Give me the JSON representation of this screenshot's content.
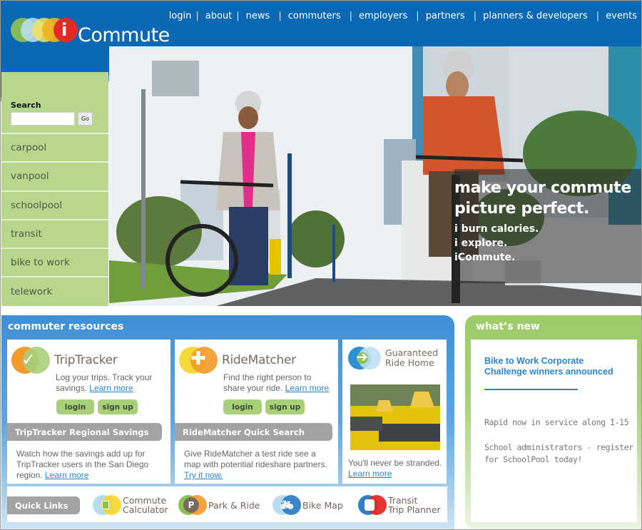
{
  "header": {
    "logo_text": "Commute",
    "logo_letter": "i",
    "nav": [
      {
        "label": "login"
      },
      {
        "label": "about"
      },
      {
        "label": "news"
      },
      {
        "label": "commuters"
      },
      {
        "label": "employers"
      },
      {
        "label": "partners"
      },
      {
        "label": "planners & developers"
      },
      {
        "label": "events"
      }
    ]
  },
  "sidebar": {
    "search_label": "Search",
    "search_value": "",
    "go_label": "Go",
    "items": [
      {
        "label": "carpool"
      },
      {
        "label": "vanpool"
      },
      {
        "label": "schoolpool"
      },
      {
        "label": "transit"
      },
      {
        "label": "bike to work"
      },
      {
        "label": "telework"
      }
    ]
  },
  "hero": {
    "headline_line1": "make your commute",
    "headline_line2": "picture perfect.",
    "sub1": "i burn calories.",
    "sub2": "i explore.",
    "sub3": "iCommute."
  },
  "resources": {
    "title": "commuter resources",
    "triptracker": {
      "name": "TripTracker",
      "desc": "Log your trips. Track your savings. ",
      "learn_more": "Learn more",
      "login": "login",
      "signup": "sign up",
      "bar_title": "TripTracker Regional Savings",
      "bottom_desc": "Watch how the savings add up for TripTracker users in the San Diego region. ",
      "bottom_link": "Learn more"
    },
    "ridematcher": {
      "name": "RideMatcher",
      "desc": "Find the right person to share your ride. ",
      "learn_more": "Learn more",
      "login": "login",
      "signup": "sign up",
      "bar_title": "RideMatcher Quick Search",
      "bottom_desc": "Give RideMatcher a test ride see a map with potential rideshare partners. ",
      "bottom_link": "Try it now."
    },
    "grh": {
      "name_line1": "Guaranteed",
      "name_line2": "Ride Home",
      "desc": "You'll never be stranded.",
      "learn_more": "Learn more"
    },
    "quick_links": {
      "label": "Quick Links",
      "items": [
        {
          "line1": "Commute",
          "line2": "Calculator",
          "icon": "calculator-icon"
        },
        {
          "line1": "Park & Ride",
          "line2": "",
          "icon": "parking-icon"
        },
        {
          "line1": "Bike Map",
          "line2": "",
          "icon": "bicycle-icon"
        },
        {
          "line1": "Transit",
          "line2": "Trip Planner",
          "icon": "bus-icon"
        }
      ]
    }
  },
  "whats_new": {
    "title": "what’s new",
    "headline": "Bike to Work Corporate Challenge winners announced",
    "items": [
      {
        "text": "Rapid now in service along I-15"
      },
      {
        "text": "School administrators - register for SchoolPool today!"
      }
    ]
  },
  "colors": {
    "header_blue": "#0a68b4",
    "sidebar_green": "#b8d78d",
    "link_blue": "#2a86cf",
    "button_green": "#a8d07a",
    "bar_gray": "#a3a3a3"
  }
}
